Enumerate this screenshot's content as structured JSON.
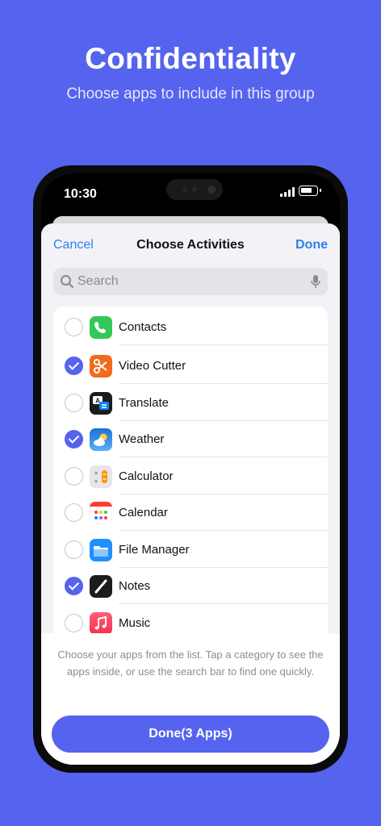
{
  "hero": {
    "title": "Confidentiality",
    "subtitle": "Choose apps to include in this group"
  },
  "status_bar": {
    "time": "10:30"
  },
  "nav": {
    "cancel_label": "Cancel",
    "title": "Choose Activities",
    "done_label": "Done"
  },
  "search": {
    "placeholder": "Search"
  },
  "apps": [
    {
      "label": "Contacts",
      "icon": "contacts-icon",
      "checked": false
    },
    {
      "label": "Video Cutter",
      "icon": "video-cutter-icon",
      "checked": true
    },
    {
      "label": "Translate",
      "icon": "translate-icon",
      "checked": false
    },
    {
      "label": "Weather",
      "icon": "weather-icon",
      "checked": true
    },
    {
      "label": "Calculator",
      "icon": "calculator-icon",
      "checked": false
    },
    {
      "label": "Calendar",
      "icon": "calendar-icon",
      "checked": false
    },
    {
      "label": "File Manager",
      "icon": "file-manager-icon",
      "checked": false
    },
    {
      "label": "Notes",
      "icon": "notes-icon",
      "checked": true
    },
    {
      "label": "Music",
      "icon": "music-icon",
      "checked": false
    }
  ],
  "footer": {
    "hint": "Choose your apps from the list. Tap a category to see the apps inside, or use the search bar to find one quickly.",
    "done_button": "Done(3 Apps)"
  },
  "colors": {
    "background": "#5663EE",
    "accent": "#5663EE",
    "link": "#2F80ED"
  }
}
